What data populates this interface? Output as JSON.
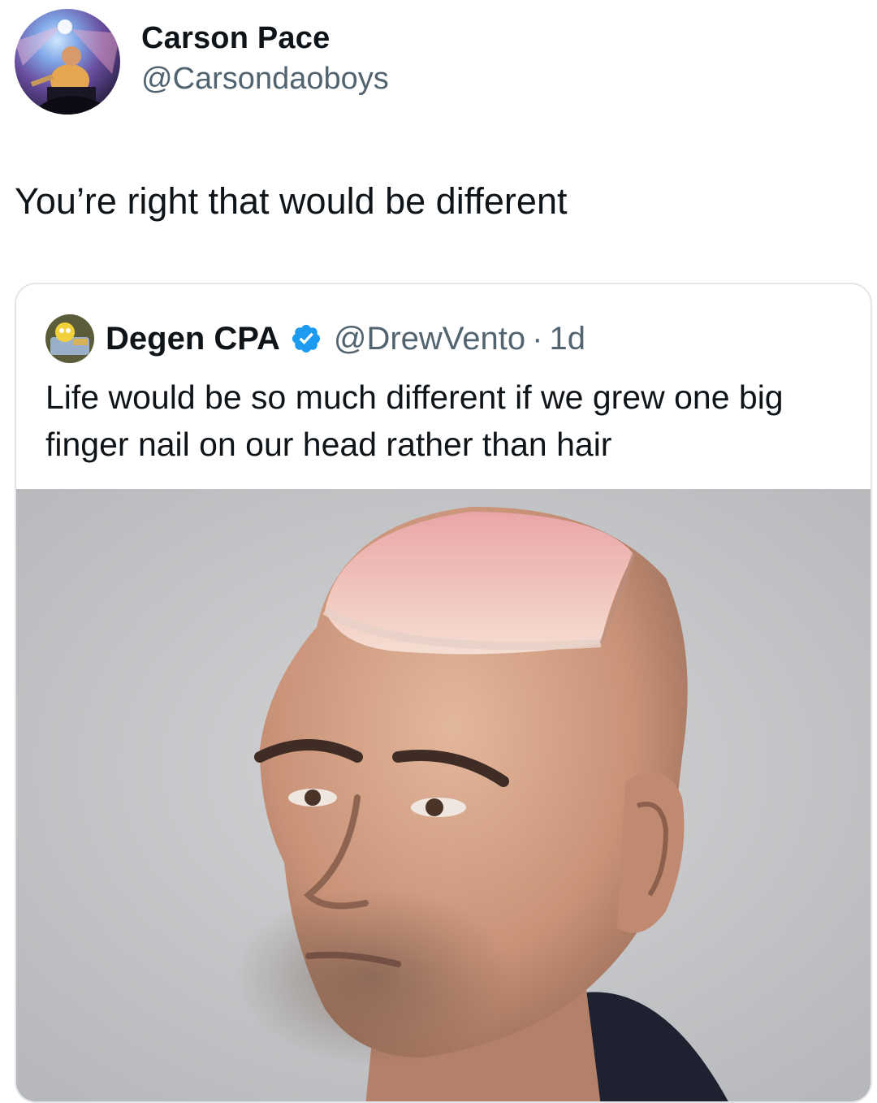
{
  "tweet": {
    "author": {
      "display_name": "Carson Pace",
      "handle": "@Carsondaoboys",
      "avatar_icon": "profile-photo-concert"
    },
    "text": "You’re right that would be different"
  },
  "quoted_tweet": {
    "author": {
      "display_name": "Degen CPA",
      "handle": "@DrewVento",
      "verified": true,
      "avatar_icon": "profile-photo-cartoon"
    },
    "separator": "·",
    "time": "1d",
    "text": "Life would be so much different if we grew one big finger nail on our head rather than hair",
    "image": {
      "description_icon": "bald-man-with-fingernail-head-photo"
    }
  },
  "colors": {
    "text_primary": "#0f1419",
    "text_secondary": "#536471",
    "verified_blue": "#1d9bf0",
    "card_border": "#e3e6e9"
  }
}
